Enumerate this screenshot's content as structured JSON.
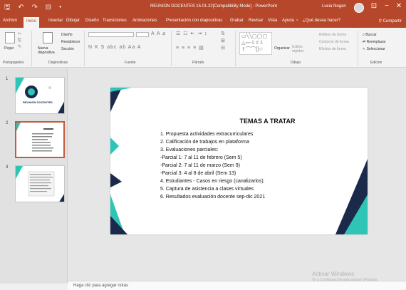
{
  "titlebar": {
    "quick_access": "🖫 ↶ ↷ ⊟ ▾",
    "document_title": "REUNION DOCENTES 15.01.22[Compatibility Mode] - PowerPoint",
    "user_name": "Lucia Negan",
    "minimize": "−",
    "restore": "❐",
    "close": "✕"
  },
  "tabs": [
    {
      "label": "Archivo"
    },
    {
      "label": "Inicio"
    },
    {
      "label": "Insertar"
    },
    {
      "label": "Dibujar"
    },
    {
      "label": "Diseño"
    },
    {
      "label": "Transiciones"
    },
    {
      "label": "Animaciones"
    },
    {
      "label": "Presentación con diapositivas"
    },
    {
      "label": "Grabar"
    },
    {
      "label": "Revisar"
    },
    {
      "label": "Vista"
    },
    {
      "label": "Ayuda"
    }
  ],
  "tell_me": "¿Qué desea hacer?",
  "share": "Compartir",
  "ribbon": {
    "clipboard": {
      "paste": "Pegar",
      "label": "Portapapeles"
    },
    "slides": {
      "new_slide": "Nueva diapositiva",
      "layout": "Diseño",
      "reset": "Restablecer",
      "section": "Sección",
      "label": "Diapositivas"
    },
    "font": {
      "label": "Fuente",
      "format_glyphs": "N K S abc ab  Aa  A"
    },
    "paragraph": {
      "label": "Párrafo"
    },
    "drawing": {
      "arrange": "Organizar",
      "quick_styles": "Estilos rápidos",
      "fill": "Relleno de forma",
      "outline": "Contorno de forma",
      "effects": "Efectos de forma",
      "label": "Dibujo"
    },
    "editing": {
      "find": "Buscar",
      "replace": "Reemplazar",
      "select": "Seleccionar",
      "label": "Edición"
    }
  },
  "thumbnails": [
    {
      "number": "1",
      "caption": "REUNIÓN DOCENTES"
    },
    {
      "number": "2",
      "caption": "TEMAS A TRATAR"
    },
    {
      "number": "3",
      "caption": ""
    }
  ],
  "slide": {
    "title": "TEMAS A TRATAR",
    "items": [
      "1. Propuesta actividades extracurriculares",
      "2. Calificación de trabajos en plataforma",
      "3. Evaluaciones parciales:",
      "-Parcial 1: 7 al 11 de febrero (Sem 5)",
      "-Parcial 2: 7 al 11 de marzo (Sem 9)",
      "-Parcial 3: 4 al 8 de abril (Sem 13)",
      "4. Estudiantes - Casos en riesgo (canalizarlos).",
      "5. Captura de asistencia a clases virtuales",
      "6. Resultados evaluación docente sep-dic 2021"
    ]
  },
  "notes_placeholder": "Haga clic para agregar notas",
  "watermark": {
    "line1": "Activar Windows",
    "line2": "Ve a Configuración para activar Windows."
  },
  "colors": {
    "accent": "#b7472a",
    "slide_teal": "#2ec4b6",
    "slide_navy": "#1b2a4a"
  }
}
